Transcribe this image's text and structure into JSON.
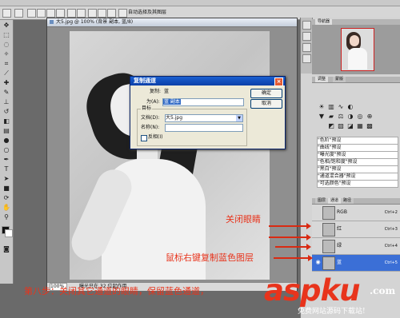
{
  "menubar": {
    "label": ""
  },
  "options_bar": {
    "mode_label": "自动选择及其图层"
  },
  "document": {
    "title": "大5.jpg @ 100% (背景 副本, 蓝/8)",
    "zoom": "100%",
    "status": "曝光只在 32 位起作用"
  },
  "dialog": {
    "title": "复制通道",
    "copy_label": "复制:",
    "copy_value": "蓝",
    "as_label": "为(A):",
    "as_value": "蓝 副本",
    "ok": "确定",
    "cancel": "取消",
    "target_group": "目标",
    "doc_label": "文档(D):",
    "doc_value": "大5.jpg",
    "name_label": "名称(N):",
    "name_value": "",
    "invert_label": "反相(I)"
  },
  "panels": {
    "navigator_tab": "导航器",
    "adjust_tabs": [
      "调整",
      "蒙版"
    ],
    "presets": [
      "\"色阶\"预设",
      "\"曲线\"预设",
      "\"曝光度\"预设",
      "\"色相/饱和度\"预设",
      "\"黑白\"预设",
      "\"通道混合器\"预设",
      "\"可选颜色\"预设"
    ],
    "layer_tabs": [
      "图层",
      "通道",
      "路径"
    ],
    "channels": [
      {
        "name": "RGB",
        "shortcut": "Ctrl+2",
        "selected": false,
        "visible": false
      },
      {
        "name": "红",
        "shortcut": "Ctrl+3",
        "selected": false,
        "visible": false
      },
      {
        "name": "绿",
        "shortcut": "Ctrl+4",
        "selected": false,
        "visible": false
      },
      {
        "name": "蓝",
        "shortcut": "Ctrl+5",
        "selected": true,
        "visible": true
      }
    ]
  },
  "annotations": {
    "close_eyes": "关闭眼睛",
    "right_click": "鼠标右键复制蓝色图层",
    "step8": "第八步：关闭其它通道的眼睛，保留蓝色通道，"
  },
  "watermark": {
    "main": "aspku",
    "suffix": ".com",
    "sub": "免费网站源码下载站!"
  },
  "colors": {
    "accent": "#e8341c",
    "selection": "#3b6fd6"
  }
}
